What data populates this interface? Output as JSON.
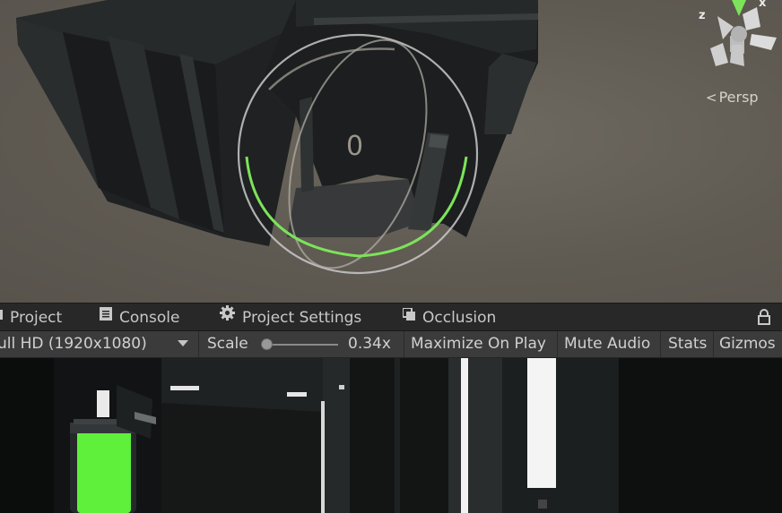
{
  "scene": {
    "rotation_value": "0",
    "axis_z_label": "z",
    "axis_x_label": "x",
    "perspective_label": "Persp",
    "icons": {
      "perspective": "perspective-arrow-icon",
      "gizmo": "orientation-gizmo-icon"
    }
  },
  "tabs": [
    {
      "label": "Project",
      "icon": "folder-icon"
    },
    {
      "label": "Console",
      "icon": "console-icon"
    },
    {
      "label": "Project Settings",
      "icon": "gear-icon"
    },
    {
      "label": "Occlusion",
      "icon": "occlusion-icon"
    }
  ],
  "toolbar": {
    "resolution": "ull HD (1920x1080)",
    "scale_label": "Scale",
    "scale_value": "0.34x",
    "maximize": "Maximize On Play",
    "mute": "Mute Audio",
    "stats": "Stats",
    "gizmos": "Gizmos"
  },
  "colors": {
    "scene_bg": "#5f5a52",
    "tab_bg": "#282828",
    "toolbar_bg": "#3b3b3b",
    "gizmo_green": "#7ce35a",
    "game_green": "#5ef03a"
  }
}
